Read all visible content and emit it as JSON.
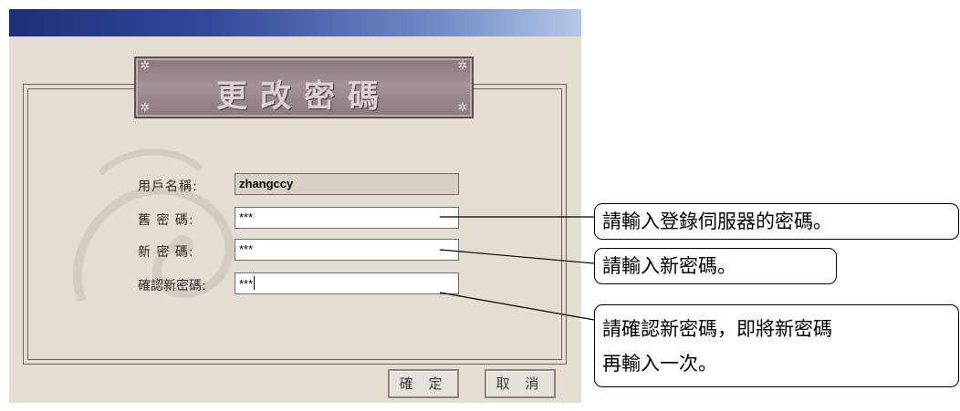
{
  "dialog": {
    "title": "更改密碼",
    "fields": {
      "username": {
        "label": "用戶名稱:",
        "value": "zhangccy"
      },
      "old_password": {
        "label": "舊 密 碼:",
        "value": "***"
      },
      "new_password": {
        "label": "新 密 碼:",
        "value": "***"
      },
      "confirm_password": {
        "label": "確認新密碼:",
        "value": "***"
      }
    },
    "buttons": {
      "ok": "確 定",
      "cancel": "取 消"
    },
    "colors": {
      "titlebar": "#1e2f7a",
      "panel": "#e3ddd2",
      "banner": "#9a888e"
    }
  },
  "callouts": {
    "old_password": "請輸入登錄伺服器的密碼。",
    "new_password": "請輸入新密碼。",
    "confirm_line1": "請確認新密碼，即將新密碼",
    "confirm_line2": "再輸入一次。"
  }
}
